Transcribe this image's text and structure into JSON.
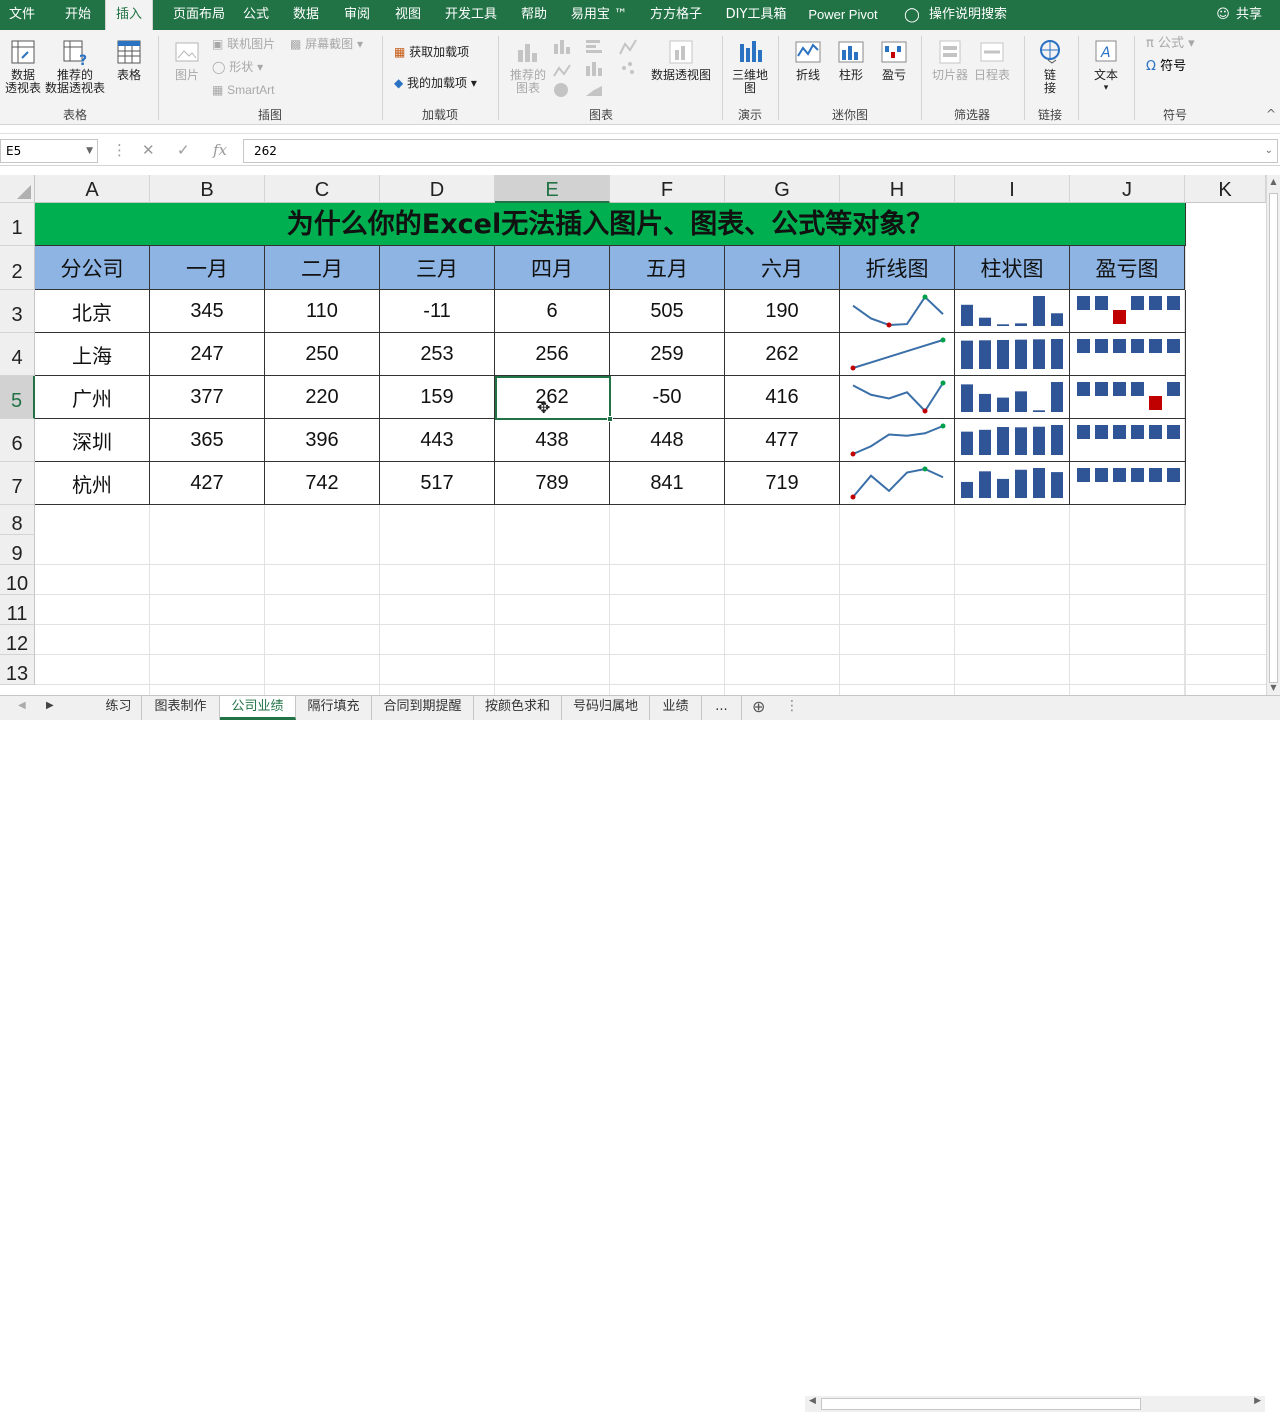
{
  "menu": {
    "tabs": [
      "文件",
      "开始",
      "插入",
      "页面布局",
      "公式",
      "数据",
      "审阅",
      "视图",
      "开发工具",
      "帮助",
      "易用宝 ™",
      "方方格子",
      "DIY工具箱",
      "Power Pivot"
    ],
    "active_index": 2,
    "tell_me": "操作说明搜索",
    "share": "共享"
  },
  "ribbon": {
    "pivot_table": "数据\n透视表",
    "recommended_pivot": "推荐的\n数据透视表",
    "table": "表格",
    "group_tables": "表格",
    "pictures": "图片",
    "online_pictures": "联机图片",
    "shapes": "形状",
    "screenshot": "屏幕截图",
    "smartart": "SmartArt",
    "group_illustrations": "插图",
    "get_addins": "获取加载项",
    "my_addins": "我的加载项",
    "group_addins": "加载项",
    "recommended_charts": "推荐的\n图表",
    "pivot_chart": "数据透视图",
    "group_charts": "图表",
    "map_3d": "三维地\n图",
    "group_tours": "演示",
    "spark_line": "折线",
    "spark_column": "柱形",
    "spark_winloss": "盈亏",
    "group_sparklines": "迷你图",
    "slicer": "切片器",
    "timeline": "日程表",
    "group_filters": "筛选器",
    "link": "链\n接",
    "group_links": "链接",
    "text": "文本",
    "equation": "公式",
    "symbol": "符号",
    "group_symbols": "符号"
  },
  "formula_bar": {
    "name_box": "E5",
    "value": "262"
  },
  "columns": [
    "A",
    "B",
    "C",
    "D",
    "E",
    "F",
    "G",
    "H",
    "I",
    "J",
    "K"
  ],
  "rows": [
    "1",
    "2",
    "3",
    "4",
    "5",
    "6",
    "7",
    "8",
    "9",
    "10",
    "11",
    "12",
    "13"
  ],
  "selected": {
    "col": "E",
    "row": "5"
  },
  "sheet": {
    "title": "为什么你的Excel无法插入图片、图表、公式等对象？",
    "headers": [
      "分公司",
      "一月",
      "二月",
      "三月",
      "四月",
      "五月",
      "六月",
      "折线图",
      "柱状图",
      "盈亏图"
    ],
    "data": [
      {
        "name": "北京",
        "values": [
          345,
          110,
          -11,
          6,
          505,
          190
        ]
      },
      {
        "name": "上海",
        "values": [
          247,
          250,
          253,
          256,
          259,
          262
        ]
      },
      {
        "name": "广州",
        "values": [
          377,
          220,
          159,
          262,
          -50,
          416
        ]
      },
      {
        "name": "深圳",
        "values": [
          365,
          396,
          443,
          438,
          448,
          477
        ]
      },
      {
        "name": "杭州",
        "values": [
          427,
          742,
          517,
          789,
          841,
          719
        ]
      }
    ]
  },
  "colors": {
    "title_bg": "#00b050",
    "header_bg": "#8db4e2",
    "spark_line": "#3a6fa8",
    "spark_high": "#00a04a",
    "spark_low": "#c00000",
    "bar": "#2f5597",
    "neg": "#c00000",
    "brand": "#217346"
  },
  "sheet_tabs": [
    "练习",
    "图表制作",
    "公司业绩",
    "隔行填充",
    "合同到期提醒",
    "按颜色求和",
    "号码归属地",
    "业绩",
    "..."
  ],
  "active_sheet_index": 2
}
